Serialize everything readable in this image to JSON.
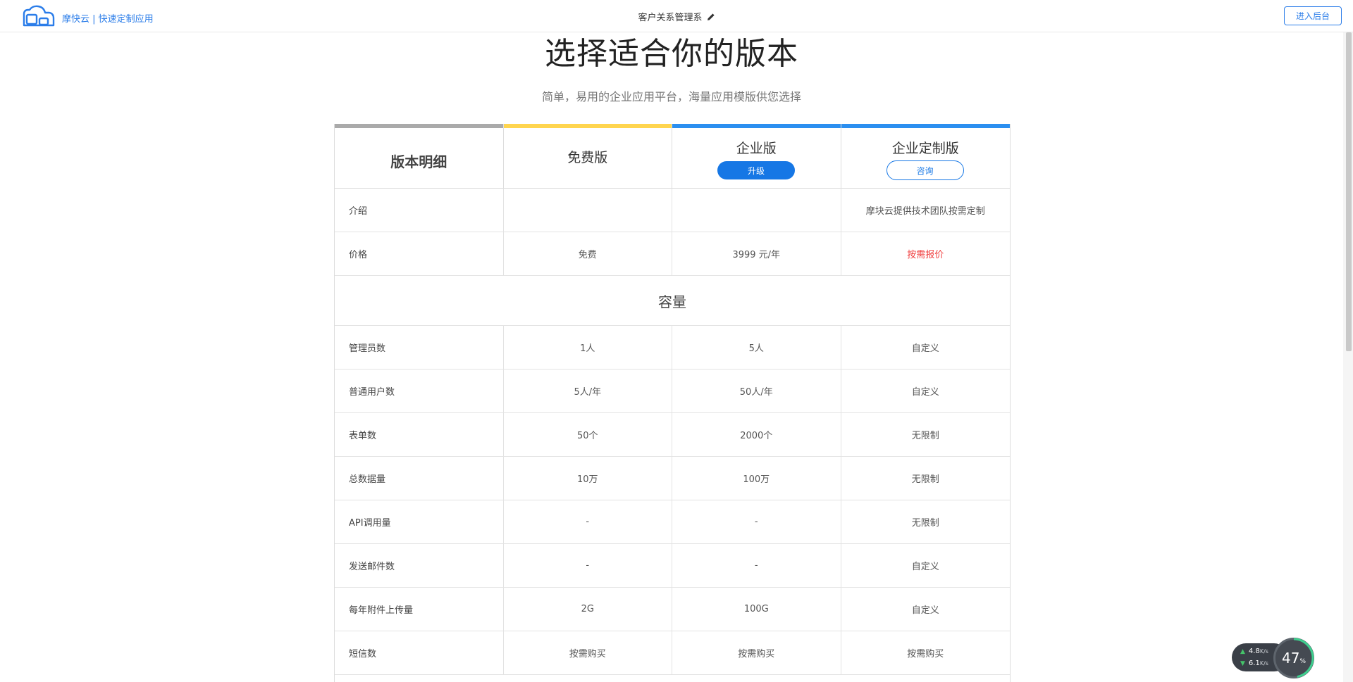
{
  "header": {
    "brand": "摩快云 | 快速定制应用",
    "app_title": "客户关系管理系",
    "enter_button": "进入后台"
  },
  "hero": {
    "title": "选择适合你的版本",
    "subtitle": "简单，易用的企业应用平台，海量应用模版供您选择"
  },
  "plans": {
    "header_label": "版本明细",
    "free": {
      "name": "免费版"
    },
    "enterprise": {
      "name": "企业版",
      "button": "升级"
    },
    "custom": {
      "name": "企业定制版",
      "button": "咨询"
    },
    "colors": {
      "gray": "#aaaaaa",
      "yellow": "#ffd54f",
      "blue": "#2b8ff0",
      "price_red": "#f04040",
      "brand_blue": "#1677e5"
    }
  },
  "rows": [
    {
      "name": "介绍",
      "free": "",
      "enterprise": "",
      "custom": "摩块云提供技术团队按需定制"
    },
    {
      "name": "价格",
      "free": "免费",
      "enterprise": "3999 元/年",
      "custom": "按需报价"
    }
  ],
  "capacity": {
    "section_title": "容量",
    "rows": [
      {
        "name": "管理员数",
        "free": "1人",
        "enterprise": "5人",
        "custom": "自定义"
      },
      {
        "name": "普通用户数",
        "free": "5人/年",
        "enterprise": "50人/年",
        "custom": "自定义"
      },
      {
        "name": "表单数",
        "free": "50个",
        "enterprise": "2000个",
        "custom": "无限制"
      },
      {
        "name": "总数据量",
        "free": "10万",
        "enterprise": "100万",
        "custom": "无限制"
      },
      {
        "name": "API调用量",
        "free": "-",
        "enterprise": "-",
        "custom": "无限制"
      },
      {
        "name": "发送邮件数",
        "free": "-",
        "enterprise": "-",
        "custom": "自定义"
      },
      {
        "name": "每年附件上传量",
        "free": "2G",
        "enterprise": "100G",
        "custom": "自定义"
      },
      {
        "name": "短信数",
        "free": "按需购买",
        "enterprise": "按需购买",
        "custom": "按需购买"
      }
    ]
  },
  "network_widget": {
    "upload": "4.8",
    "upload_unit": "K/s",
    "download": "6.1",
    "download_unit": "K/s",
    "percent": "47",
    "percent_unit": "%",
    "percent_value": 47
  }
}
